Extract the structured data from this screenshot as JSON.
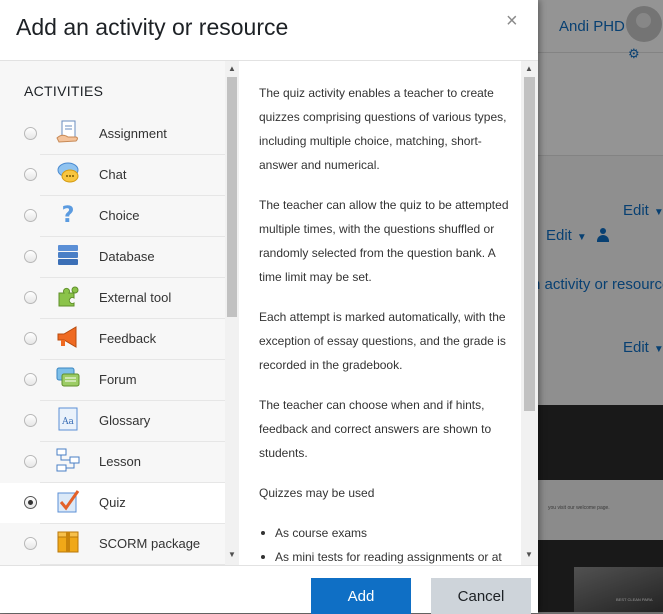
{
  "background": {
    "user_name": "Andi PHD",
    "edit_label": "Edit",
    "link_text": "n activity or resource",
    "footer_text": "you visit our welcome page.",
    "photo_caption": "BEST CLEAN PARA"
  },
  "modal": {
    "title": "Add an activity or resource",
    "close_symbol": "×",
    "section_title": "ACTIVITIES",
    "items": [
      {
        "label": "Assignment",
        "icon": "assignment-icon",
        "selected": false
      },
      {
        "label": "Chat",
        "icon": "chat-icon",
        "selected": false
      },
      {
        "label": "Choice",
        "icon": "choice-icon",
        "selected": false
      },
      {
        "label": "Database",
        "icon": "database-icon",
        "selected": false
      },
      {
        "label": "External tool",
        "icon": "external-tool-icon",
        "selected": false
      },
      {
        "label": "Feedback",
        "icon": "feedback-icon",
        "selected": false
      },
      {
        "label": "Forum",
        "icon": "forum-icon",
        "selected": false
      },
      {
        "label": "Glossary",
        "icon": "glossary-icon",
        "selected": false
      },
      {
        "label": "Lesson",
        "icon": "lesson-icon",
        "selected": false
      },
      {
        "label": "Quiz",
        "icon": "quiz-icon",
        "selected": true
      },
      {
        "label": "SCORM package",
        "icon": "scorm-icon",
        "selected": false
      }
    ],
    "description": {
      "p1": "The quiz activity enables a teacher to create quizzes comprising questions of various types, including multiple choice, matching, short-answer and numerical.",
      "p2": "The teacher can allow the quiz to be attempted multiple times, with the questions shuffled or randomly selected from the question bank. A time limit may be set.",
      "p3": "Each attempt is marked automatically, with the exception of essay questions, and the grade is recorded in the gradebook.",
      "p4": "The teacher can choose when and if hints, feedback and correct answers are shown to students.",
      "p5": "Quizzes may be used",
      "bullets": [
        "As course exams",
        "As mini tests for reading assignments or at"
      ]
    },
    "add_label": "Add",
    "cancel_label": "Cancel"
  },
  "colors": {
    "primary": "#0f6fc5",
    "cancel_bg": "#ced4da",
    "list_bg": "#f7f7f7"
  }
}
